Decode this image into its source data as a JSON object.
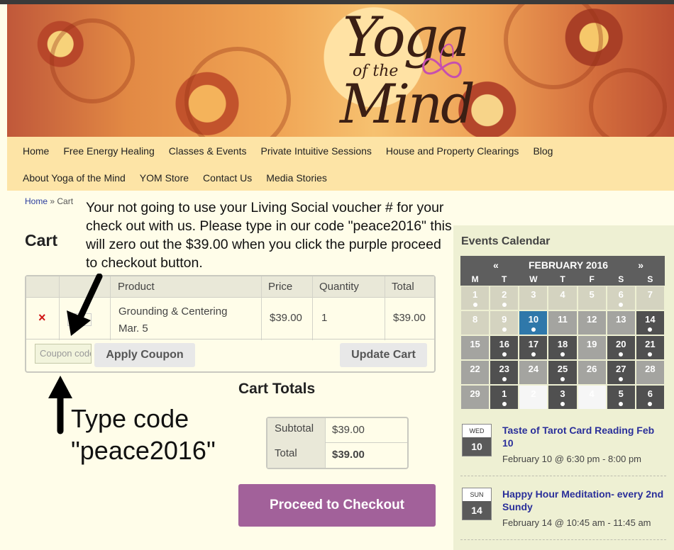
{
  "site": {
    "logo_text": {
      "line1": "Yoga",
      "line2": "of the",
      "line3": "Mind"
    }
  },
  "nav": {
    "row1": [
      "Home",
      "Free Energy Healing",
      "Classes & Events",
      "Private Intuitive Sessions",
      "House and Property Clearings",
      "Blog"
    ],
    "row2": [
      "About Yoga of the Mind",
      "YOM Store",
      "Contact Us",
      "Media Stories"
    ]
  },
  "breadcrumb": {
    "home": "Home",
    "separator": " » ",
    "current": "Cart"
  },
  "annotation_text": "Your not going to use your Living Social voucher # for your check out with us.  Please type in our code \"peace2016\" this will zero out the $39.00 when you click the purple proceed to checkout button.",
  "type_code_note": {
    "line1": "Type code",
    "line2": "\"peace2016\""
  },
  "cart": {
    "heading": "Cart",
    "columns": {
      "product": "Product",
      "price": "Price",
      "quantity": "Quantity",
      "total": "Total"
    },
    "item": {
      "remove": "×",
      "name_line1": "Grounding & Centering",
      "name_line2": "Mar. 5",
      "price": "$39.00",
      "quantity": "1",
      "total": "$39.00"
    },
    "coupon_placeholder": "Coupon code",
    "apply_coupon": "Apply Coupon",
    "update_cart": "Update Cart"
  },
  "totals": {
    "heading": "Cart Totals",
    "subtotal_label": "Subtotal",
    "subtotal_value": "$39.00",
    "total_label": "Total",
    "total_value": "$39.00",
    "checkout_button": "Proceed to Checkout"
  },
  "sidebar": {
    "title": "Events Calendar",
    "calendar": {
      "prev": "«",
      "month": "FEBRUARY 2016",
      "next": "»",
      "weekdays": [
        "M",
        "T",
        "W",
        "T",
        "F",
        "S",
        "S"
      ],
      "days": [
        {
          "n": "1",
          "style": "pale",
          "dot": true
        },
        {
          "n": "2",
          "style": "pale",
          "dot": true
        },
        {
          "n": "3",
          "style": "pale",
          "dot": false
        },
        {
          "n": "4",
          "style": "pale",
          "dot": false
        },
        {
          "n": "5",
          "style": "pale",
          "dot": false
        },
        {
          "n": "6",
          "style": "pale",
          "dot": true
        },
        {
          "n": "7",
          "style": "pale",
          "dot": false
        },
        {
          "n": "8",
          "style": "pale",
          "dot": false
        },
        {
          "n": "9",
          "style": "pale",
          "dot": true
        },
        {
          "n": "10",
          "style": "blue",
          "dot": true
        },
        {
          "n": "11",
          "style": "gray",
          "dot": false
        },
        {
          "n": "12",
          "style": "gray",
          "dot": false
        },
        {
          "n": "13",
          "style": "gray",
          "dot": false
        },
        {
          "n": "14",
          "style": "dark",
          "dot": true
        },
        {
          "n": "15",
          "style": "gray",
          "dot": false
        },
        {
          "n": "16",
          "style": "dark",
          "dot": true
        },
        {
          "n": "17",
          "style": "dark",
          "dot": true
        },
        {
          "n": "18",
          "style": "dark",
          "dot": true
        },
        {
          "n": "19",
          "style": "gray",
          "dot": false
        },
        {
          "n": "20",
          "style": "dark",
          "dot": true
        },
        {
          "n": "21",
          "style": "dark",
          "dot": true
        },
        {
          "n": "22",
          "style": "gray",
          "dot": false
        },
        {
          "n": "23",
          "style": "dark",
          "dot": true
        },
        {
          "n": "24",
          "style": "gray",
          "dot": false
        },
        {
          "n": "25",
          "style": "dark",
          "dot": true
        },
        {
          "n": "26",
          "style": "gray",
          "dot": false
        },
        {
          "n": "27",
          "style": "dark",
          "dot": true
        },
        {
          "n": "28",
          "style": "gray",
          "dot": false
        },
        {
          "n": "29",
          "style": "gray",
          "dot": false
        },
        {
          "n": "1",
          "style": "dark",
          "dot": true
        },
        {
          "n": "2",
          "style": "white",
          "dot": false
        },
        {
          "n": "3",
          "style": "dark",
          "dot": true
        },
        {
          "n": "4",
          "style": "white",
          "dot": false
        },
        {
          "n": "5",
          "style": "dark",
          "dot": true
        },
        {
          "n": "6",
          "style": "dark",
          "dot": true
        }
      ]
    },
    "events": [
      {
        "weekday": "WED",
        "day": "10",
        "title": "Taste of Tarot Card Reading Feb 10",
        "time": "February 10 @ 6:30 pm - 8:00 pm"
      },
      {
        "weekday": "SUN",
        "day": "14",
        "title": "Happy Hour Meditation- every 2nd Sundy",
        "time": "February 14 @ 10:45 am - 11:45 am"
      }
    ]
  },
  "colors": {
    "page_bg": "#fffde9",
    "nav_bg": "#fde4a6",
    "checkout_purple": "#a2619a",
    "remove_red": "#d01515",
    "link_blue": "#2a3d9e",
    "calendar_today_blue": "#2f78aa"
  }
}
